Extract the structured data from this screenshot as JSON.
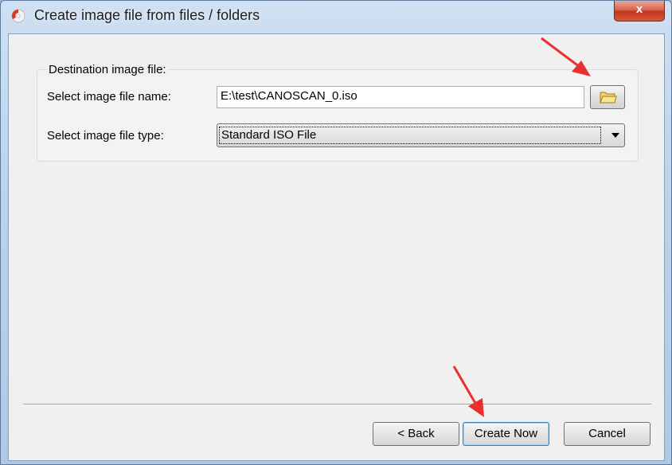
{
  "window": {
    "title": "Create image file from files / folders",
    "close_label": "x"
  },
  "destination": {
    "group_title": "Destination image file:",
    "file_name_label": "Select image file name:",
    "file_name_value": "E:\\test\\CANOSCAN_0.iso",
    "file_type_label": "Select image file type:",
    "file_type_value": "Standard ISO File",
    "browse_icon": "folder-icon"
  },
  "buttons": {
    "back": "< Back",
    "create_now": "Create Now",
    "cancel": "Cancel"
  },
  "colors": {
    "annotation_arrow": "#e83030",
    "close_button": "#c1361c"
  }
}
